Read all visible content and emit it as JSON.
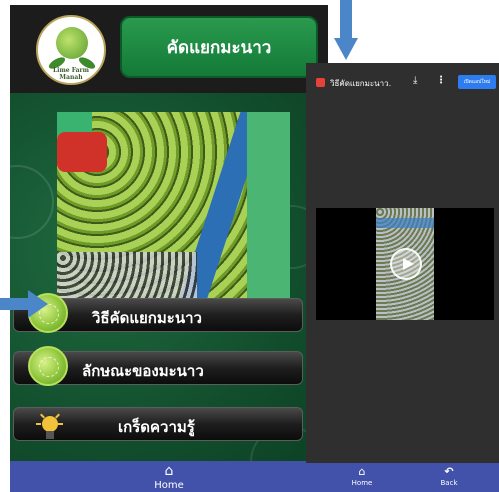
{
  "left_screen": {
    "logo": {
      "text": "Lime Farm Manah",
      "icon": "lime-logo-icon"
    },
    "title": "คัดแยกมะนาว",
    "photo": {
      "icon": "lime-sorting-photo"
    },
    "menu": [
      {
        "label": "วิธีคัดแยกมะนาว",
        "icon": "lime-slice-icon"
      },
      {
        "label": "ลักษณะของมะนาว",
        "icon": "lime-slice-icon"
      },
      {
        "label": "เกร็ดความรู้",
        "icon": "lightbulb-icon"
      }
    ],
    "tabbar": {
      "home_label": "Home",
      "home_icon": "home-icon"
    }
  },
  "right_screen": {
    "video_title": "วิธีคัดแยกมะนาว.",
    "open_app_label": "เปิดแอปใหม่",
    "icons": [
      "video-app-icon",
      "download-icon",
      "more-vert-icon",
      "play-icon"
    ],
    "tabbar": {
      "home_label": "Home",
      "back_label": "Back"
    }
  },
  "colors": {
    "header_green": "#1f8a43",
    "tabbar_blue": "#4251a9",
    "arrow_blue": "#4b86c8",
    "dark_bg": "#2f2f2f"
  }
}
